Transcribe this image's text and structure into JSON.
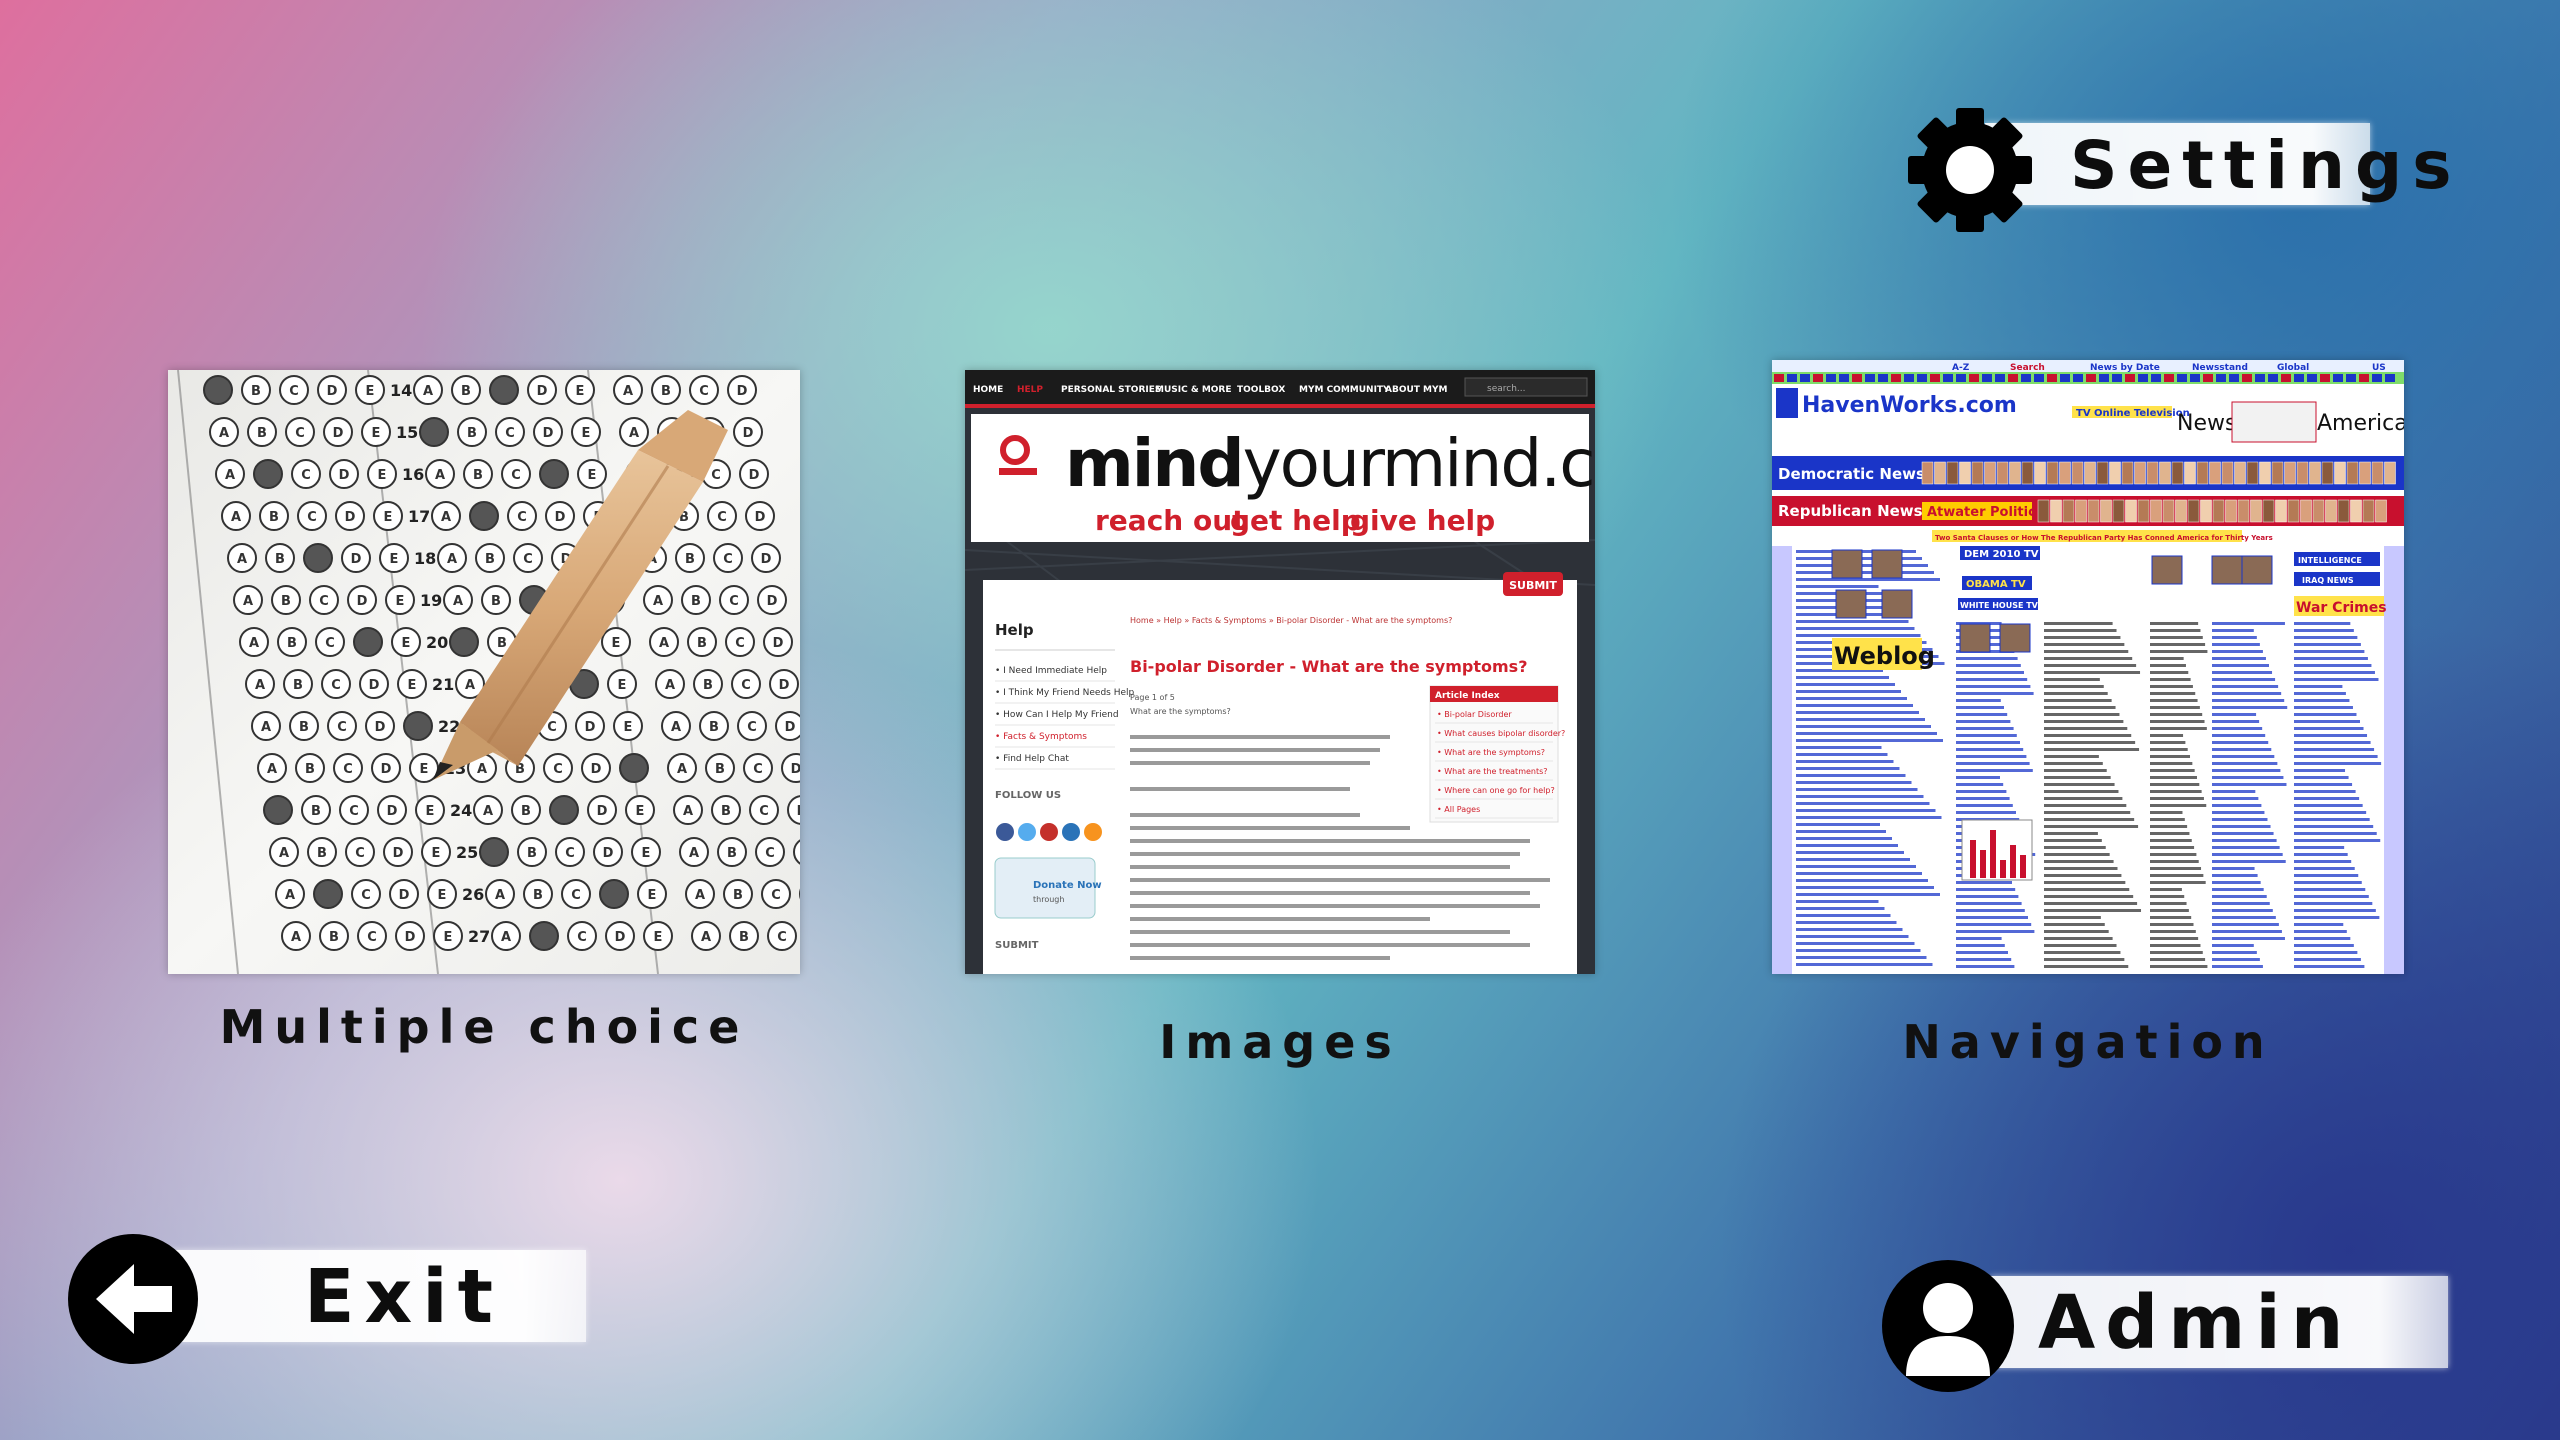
{
  "settings": {
    "label": "Settings",
    "icon": "gear-icon"
  },
  "exit": {
    "label": "Exit",
    "icon": "arrow-left-icon"
  },
  "admin": {
    "label": "Admin",
    "icon": "user-icon"
  },
  "tiles": [
    {
      "label": "Multiple choice",
      "thumbnail": "answer-sheet-with-pencil"
    },
    {
      "label": "Images",
      "thumbnail": "mindyourmind-website",
      "site": {
        "nav": [
          "HOME",
          "HELP",
          "PERSONAL STORIES",
          "MUSIC & MORE",
          "TOOLBOX",
          "MYM COMMUNITY",
          "ABOUT MYM"
        ],
        "search": "search...",
        "logo": "mindyourmind.ca",
        "logo_bold": "mind",
        "logo_rest": "yourmind.ca",
        "tagline": [
          "reach out",
          "get help",
          "give help"
        ],
        "submit": "SUBMIT",
        "sidebar_title": "Help",
        "sidebar_items": [
          "I Need Immediate Help",
          "I Think My Friend Needs Help",
          "How Can I Help My Friend",
          "Facts & Symptoms",
          "Find Help Chat"
        ],
        "follow_us": "FOLLOW US",
        "donate": "Donate Now",
        "donate_sub": "through",
        "submit_side": "SUBMIT",
        "breadcrumb": "Home » Help » Facts & Symptoms » Bi-polar Disorder - What are the symptoms?",
        "article_title": "Bi-polar Disorder - What are the symptoms?",
        "page_info": "Page 1 of 5",
        "lead": "What are the symptoms?",
        "article_index_title": "Article Index",
        "article_index": [
          "Bi-polar Disorder",
          "What causes bipolar disorder?",
          "What are the symptoms?",
          "What are the treatments?",
          "Where can one go for help?",
          "All Pages"
        ]
      }
    },
    {
      "label": "Navigation",
      "thumbnail": "havenworks-website",
      "site": {
        "title": "HavenWorks.com",
        "links": [
          "A-Z",
          "Search",
          "News by Date",
          "Newsstand",
          "Global",
          "US"
        ],
        "news": "News",
        "america": "America",
        "democratic": "Democratic News:",
        "republican": "Republican News:",
        "atwater": "Atwater Politics",
        "headline": "Two Santa Clauses or How The Republican Party Has Conned America for Thirty Years",
        "weblog": "Weblog",
        "obama": "OBAMA TV",
        "war_crimes": "War Crimes",
        "white_house": "WHITE HOUSE TV",
        "intelligence": "INTELLIGENCE",
        "iraq": "IRAQ NEWS",
        "dem_tv": "DEM 2010 TV",
        "tv_online": "TV Online Television"
      }
    }
  ],
  "colors": {
    "mym_red": "#d0202c",
    "mym_nav": "#1e1e1e",
    "haven_blue": "#1a35c8",
    "haven_red": "#c8102e",
    "haven_yellow": "#ffe24a"
  }
}
